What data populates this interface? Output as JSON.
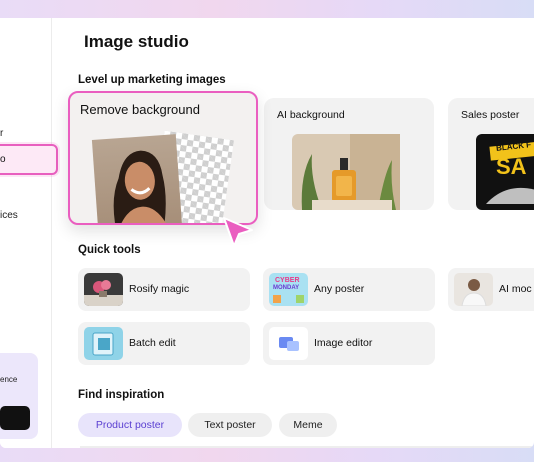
{
  "page": {
    "title": "Image studio"
  },
  "sidebar": {
    "items": [
      {
        "label": "r"
      },
      {
        "label": "o"
      },
      {
        "label": "ices"
      }
    ],
    "promo": {
      "text": "ence"
    }
  },
  "sections": {
    "level_up": "Level up marketing images",
    "quick_tools": "Quick tools",
    "find_inspiration": "Find inspiration"
  },
  "feature_cards": [
    {
      "label": "Remove background"
    },
    {
      "label": "AI background"
    },
    {
      "label": "Sales poster"
    }
  ],
  "sales_poster_text": {
    "line1": "BLACK F",
    "line2": "SA"
  },
  "quick_tools": [
    {
      "label": "Rosify magic"
    },
    {
      "label": "Any poster"
    },
    {
      "label": "AI moc"
    },
    {
      "label": "Batch edit"
    },
    {
      "label": "Image editor"
    }
  ],
  "any_poster_thumb": {
    "line1": "CYBER",
    "line2": "MONDAY"
  },
  "inspiration_chips": [
    {
      "label": "Product poster",
      "active": true
    },
    {
      "label": "Text poster",
      "active": false
    },
    {
      "label": "Meme",
      "active": false
    }
  ],
  "colors": {
    "accent_pink": "#ea5ec0",
    "chip_active_text": "#5a3fd1",
    "chip_active_bg": "#e8e4fb"
  }
}
